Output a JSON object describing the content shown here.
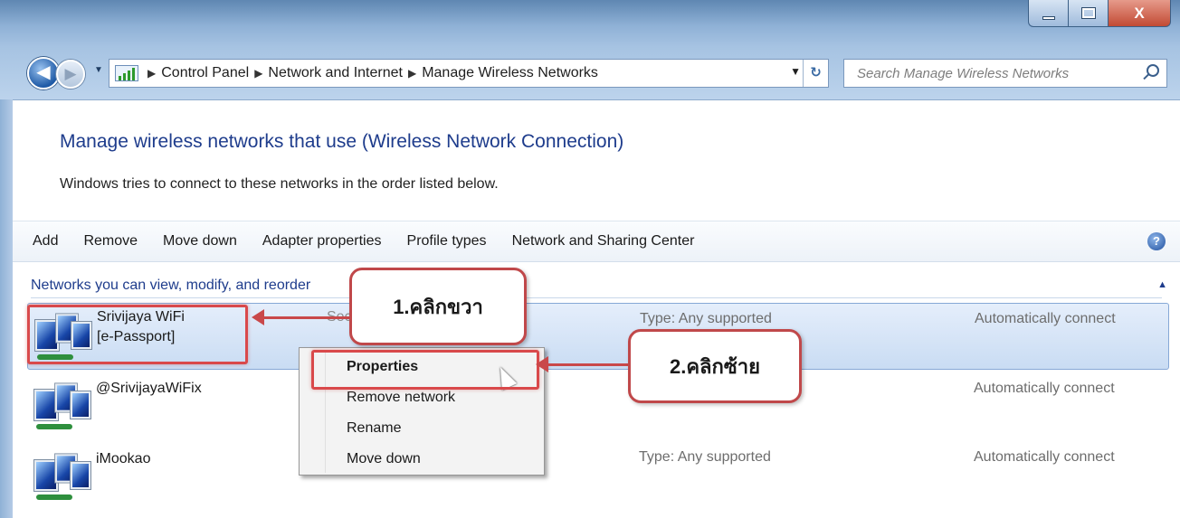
{
  "window": {
    "title_buttons": {
      "minimize": "–",
      "maximize": "□",
      "close": "X"
    }
  },
  "address_bar": {
    "breadcrumbs": [
      "Control Panel",
      "Network and Internet",
      "Manage Wireless Networks"
    ],
    "refresh_icon": "refresh-icon"
  },
  "search": {
    "placeholder": "Search Manage Wireless Networks"
  },
  "content": {
    "heading": "Manage wireless networks that use (Wireless Network Connection)",
    "subtext": "Windows tries to connect to these networks in the order listed below."
  },
  "toolbar": {
    "items": [
      "Add",
      "Remove",
      "Move down",
      "Adapter properties",
      "Profile types",
      "Network and Sharing Center"
    ]
  },
  "network_list": {
    "group_header": "Networks you can view, modify, and reorder",
    "networks": [
      {
        "name": "Srivijaya WiFi",
        "name2": "[e-Passport]",
        "security_partial": "Sec",
        "type": "Type: Any supported",
        "mode": "Automatically connect"
      },
      {
        "name": "@SrivijayaWiFix",
        "type": "",
        "mode": "Automatically connect"
      },
      {
        "name": "iMookao",
        "type": "Type: Any supported",
        "mode": "Automatically connect"
      }
    ]
  },
  "context_menu": {
    "items": [
      "Properties",
      "Remove network",
      "Rename",
      "Move down"
    ]
  },
  "annotations": {
    "step1": "1.คลิกขวา",
    "step2": "2.คลิกซ้าย",
    "highlight_color": "#d9494b"
  }
}
